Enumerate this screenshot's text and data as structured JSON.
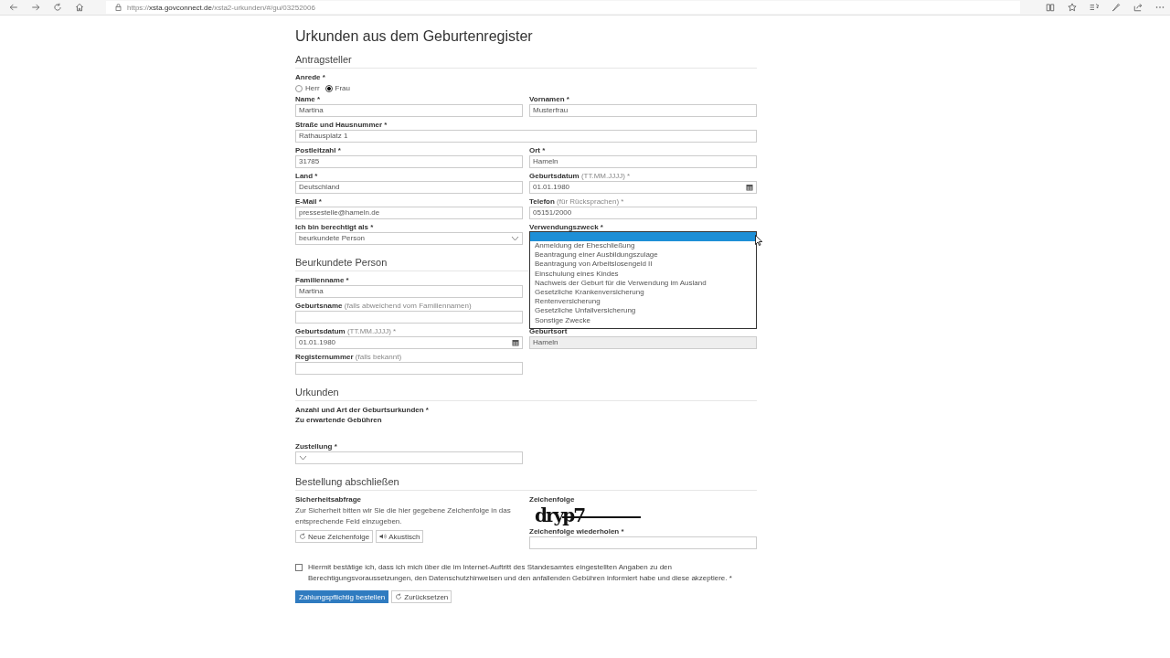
{
  "browser": {
    "url_scheme": "https://",
    "url_host": "xsta.govconnect.de",
    "url_path": "/xsta2-urkunden/#/gu/03252006"
  },
  "title": "Urkunden aus dem Geburtenregister",
  "sections": [
    {
      "heading": "Antragsteller",
      "rows": [
        [
          {
            "kind": "radio",
            "label": "Anrede *",
            "options": [
              {
                "label": "Herr",
                "selected": false
              },
              {
                "label": "Frau",
                "selected": true
              }
            ]
          }
        ],
        [
          {
            "kind": "text",
            "label": "Name *",
            "value": "Martina"
          },
          {
            "kind": "text",
            "label": "Vornamen *",
            "value": "Musterfrau"
          }
        ],
        [
          {
            "kind": "text",
            "label": "Straße und Hausnummer *",
            "value": "Rathausplatz 1",
            "wide": true
          }
        ],
        [
          {
            "kind": "text",
            "label": "Postleitzahl *",
            "value": "31785"
          },
          {
            "kind": "text",
            "label": "Ort *",
            "value": "Hameln"
          }
        ],
        [
          {
            "kind": "text",
            "label": "Land *",
            "value": "Deutschland"
          },
          {
            "kind": "date",
            "label": "Geburtsdatum",
            "hint": "(TT.MM.JJJJ) *",
            "value": "01.01.1980"
          }
        ],
        [
          {
            "kind": "text",
            "label": "E-Mail *",
            "value": "pressestelle@hameln.de"
          },
          {
            "kind": "text",
            "label": "Telefon",
            "hint": "(für Rücksprachen) *",
            "value": "05151/2000"
          }
        ],
        [
          {
            "kind": "select",
            "label": "Ich bin berechtigt als *",
            "value": "beurkundete Person"
          },
          {
            "kind": "dropdown",
            "label": "Verwendungszweck *",
            "open": true,
            "options": [
              {
                "label": "Anmeldung der Eheschließung",
                "selected": false
              },
              {
                "label": "Beantragung einer Ausbildungszulage",
                "selected": false
              },
              {
                "label": "Beantragung von Arbeitslosengeld II",
                "selected": false
              },
              {
                "label": "Einschulung eines Kindes",
                "selected": false
              },
              {
                "label": "Nachweis der Geburt für die Verwendung im Ausland",
                "selected": false
              },
              {
                "label": "Gesetzliche Krankenversicherung",
                "selected": false
              },
              {
                "label": "Rentenversicherung",
                "selected": false
              },
              {
                "label": "Gesetzliche Unfallversicherung",
                "selected": false
              },
              {
                "label": "Sonstige Zwecke",
                "selected": false
              }
            ]
          }
        ]
      ]
    },
    {
      "heading": "Beurkundete Person",
      "rows": [
        [
          {
            "kind": "text",
            "label": "Familienname *",
            "value": "Martina"
          }
        ],
        [
          {
            "kind": "text",
            "label": "Geburtsname",
            "hint": "(falls abweichend vom Familiennamen)"
          }
        ],
        [
          {
            "kind": "date",
            "label": "Geburtsdatum",
            "hint": "(TT.MM.JJJJ) *",
            "value": "01.01.1980"
          },
          {
            "kind": "readonly",
            "label": "Geburtsort",
            "value": "Hameln"
          }
        ],
        [
          {
            "kind": "text",
            "label": "Registernummer",
            "hint": "(falls bekannt)"
          }
        ]
      ]
    },
    {
      "heading": "Urkunden",
      "rows": [
        [
          {
            "kind": "static",
            "label": "Anzahl und Art der Geburtsurkunden *"
          }
        ],
        [
          {
            "kind": "static",
            "label": "Zu erwartende Gebühren"
          }
        ],
        [
          {
            "kind": "select",
            "label": "Zustellung *"
          }
        ]
      ]
    }
  ],
  "order": {
    "heading": "Bestellung abschließen",
    "security_label": "Sicherheitsabfrage",
    "security_text": "Zur Sicherheit bitten wir Sie die hier gegebene Zeichenfolge in das entsprechende Feld einzugeben.",
    "new_button": "Neue Zeichenfolge",
    "audio_button": "Akustisch",
    "captcha_label": "Zeichenfolge",
    "captcha": "dryp7",
    "repeat_label": "Zeichenfolge wiederholen *",
    "consent": {
      "checked": false,
      "text": "Hiermit bestätige ich, dass ich mich über die im Internet-Auftritt des Standesamtes eingestellten Angaben zu den Berechtigungsvoraussetzungen, den Datenschutzhinweisen und den anfallenden Gebühren informiert habe und diese akzeptiere. *"
    },
    "submit": "Zahlungspflichtig bestellen",
    "reset": "Zurücksetzen"
  }
}
